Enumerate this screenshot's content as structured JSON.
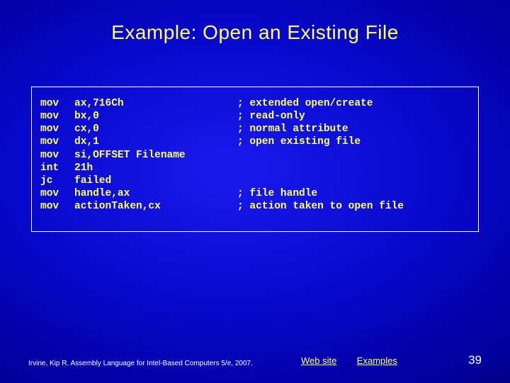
{
  "title": "Example: Open an Existing File",
  "code": [
    {
      "inst": "mov",
      "args": "ax,716Ch",
      "comment": "; extended open/create"
    },
    {
      "inst": "mov",
      "args": "bx,0",
      "comment": "; read-only"
    },
    {
      "inst": "mov",
      "args": "cx,0",
      "comment": "; normal attribute"
    },
    {
      "inst": "mov",
      "args": "dx,1",
      "comment": "; open existing file"
    },
    {
      "inst": "mov",
      "args": "si,OFFSET Filename",
      "comment": ""
    },
    {
      "inst": "int",
      "args": "21h",
      "comment": ""
    },
    {
      "inst": "jc",
      "args": "failed",
      "comment": ""
    },
    {
      "inst": "mov",
      "args": "handle,ax",
      "comment": "; file handle"
    },
    {
      "inst": "mov",
      "args": "actionTaken,cx",
      "comment": "; action taken to open file"
    }
  ],
  "citation": "Irvine, Kip R. Assembly Language for Intel-Based Computers 5/e, 2007.",
  "links": {
    "website": "Web site",
    "examples": "Examples"
  },
  "page": "39"
}
